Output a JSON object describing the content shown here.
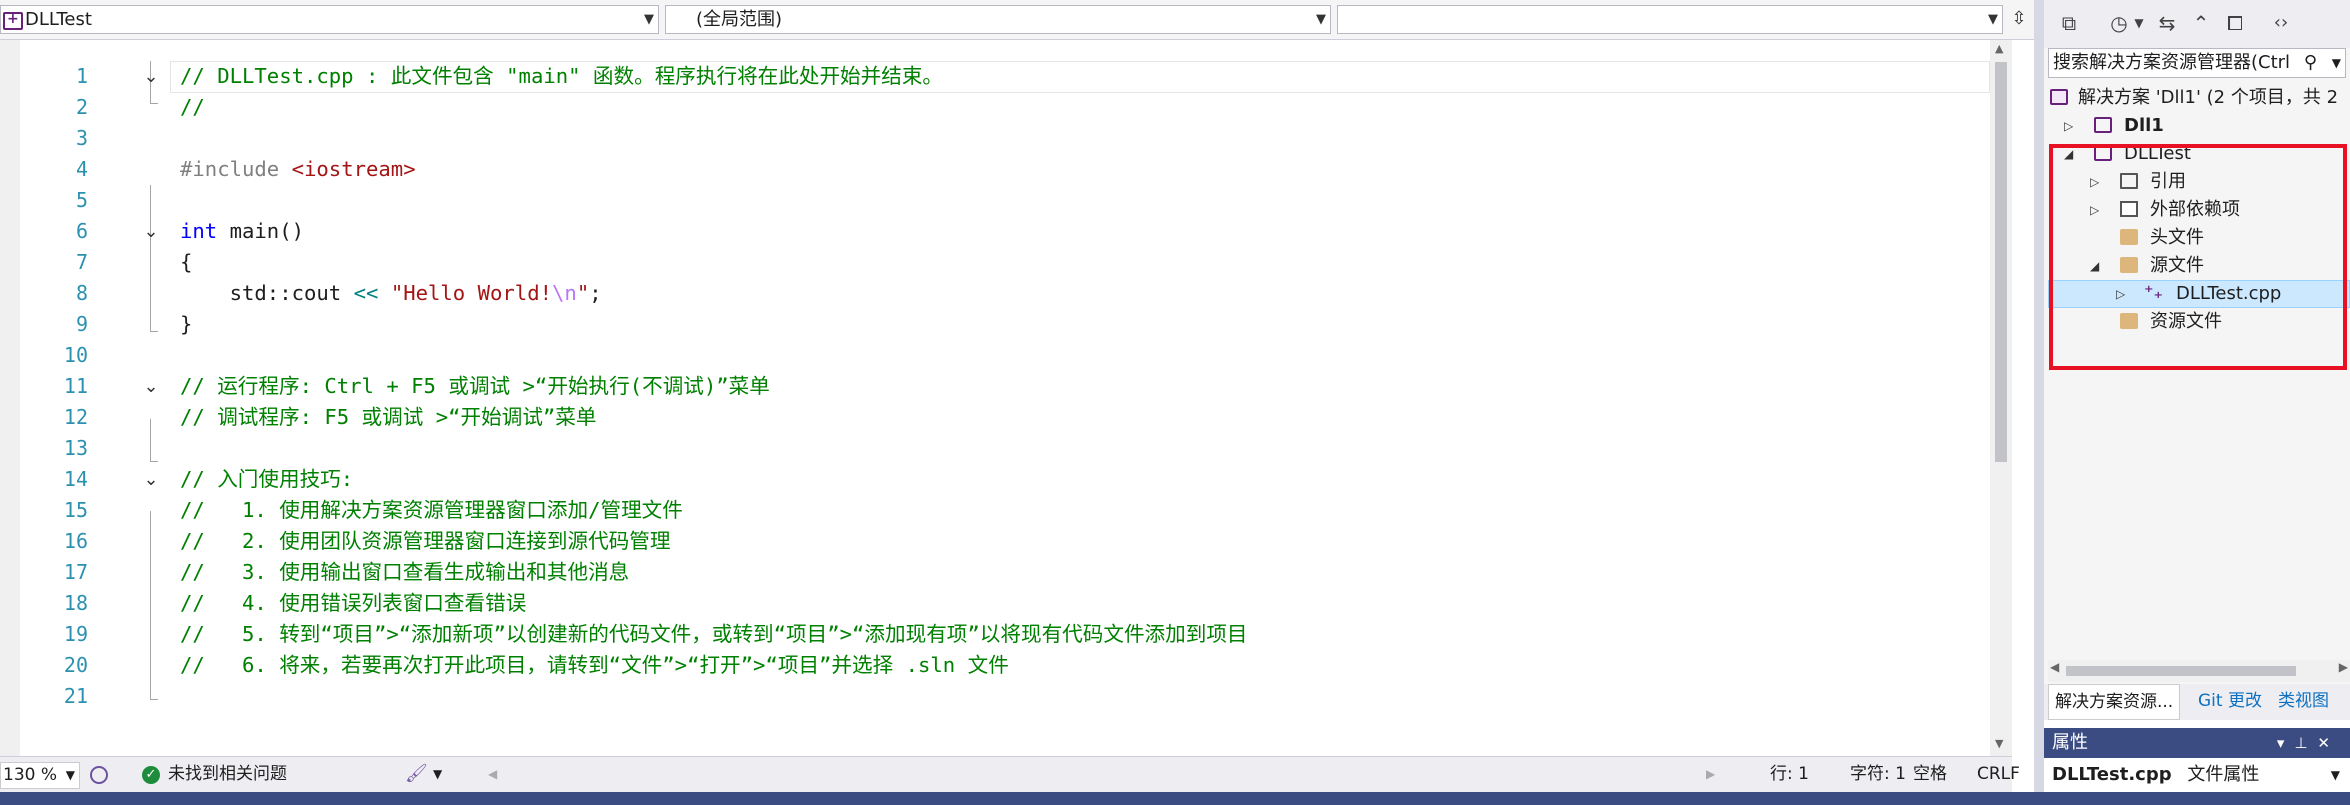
{
  "navbar": {
    "file_combo": "DLLTest",
    "scope_combo": "(全局范围)",
    "member_combo": ""
  },
  "editor": {
    "lines": [
      {
        "n": "1"
      },
      {
        "n": "2"
      },
      {
        "n": "3"
      },
      {
        "n": "4"
      },
      {
        "n": "5"
      },
      {
        "n": "6"
      },
      {
        "n": "7"
      },
      {
        "n": "8"
      },
      {
        "n": "9"
      },
      {
        "n": "10"
      },
      {
        "n": "11"
      },
      {
        "n": "12"
      },
      {
        "n": "13"
      },
      {
        "n": "14"
      },
      {
        "n": "15"
      },
      {
        "n": "16"
      },
      {
        "n": "17"
      },
      {
        "n": "18"
      },
      {
        "n": "19"
      },
      {
        "n": "20"
      },
      {
        "n": "21"
      }
    ],
    "code": {
      "l1": "// DLLTest.cpp : 此文件包含 \"main\" 函数。程序执行将在此处开始并结束。",
      "l2": "//",
      "l4_directive": "#include",
      "l4_header": "<iostream>",
      "l6_kw": "int",
      "l6_rest": " main()",
      "l7": "{",
      "l8_lead": "    std::cout ",
      "l8_op": "<<",
      "l8_str": "\"Hello World!",
      "l8_esc": "\\n",
      "l8_strend": "\"",
      "l8_end": ";",
      "l9": "}",
      "l11": "// 运行程序: Ctrl + F5 或调试 >“开始执行(不调试)”菜单",
      "l12": "// 调试程序: F5 或调试 >“开始调试”菜单",
      "l14": "// 入门使用技巧:",
      "l15": "//   1. 使用解决方案资源管理器窗口添加/管理文件",
      "l16": "//   2. 使用团队资源管理器窗口连接到源代码管理",
      "l17": "//   3. 使用输出窗口查看生成输出和其他消息",
      "l18": "//   4. 使用错误列表窗口查看错误",
      "l19": "//   5. 转到“项目”>“添加新项”以创建新的代码文件，或转到“项目”>“添加现有项”以将现有代码文件添加到项目",
      "l20": "//   6. 将来，若要再次打开此项目，请转到“文件”>“打开”>“项目”并选择 .sln 文件"
    }
  },
  "statusbar": {
    "zoom": "130 %",
    "issues": "未找到相关问题",
    "line": "行: 1",
    "char": "字符: 1",
    "spacing": "空格",
    "eol": "CRLF"
  },
  "solution_explorer": {
    "search_placeholder": "搜索解决方案资源管理器(Ctrl",
    "solution": "解决方案 'Dll1' (2 个项目，共 2",
    "nodes": {
      "dll1": "Dll1",
      "dlltest": "DLLTest",
      "references": "引用",
      "external": "外部依赖项",
      "headers": "头文件",
      "sources": "源文件",
      "cppfile": "DLLTest.cpp",
      "resources": "资源文件"
    },
    "tabs": {
      "solution_explorer": "解决方案资源...",
      "git": "Git 更改",
      "class_view": "类视图"
    }
  },
  "properties": {
    "title": "属性",
    "object_name": "DLLTest.cpp",
    "object_type": "文件属性"
  }
}
